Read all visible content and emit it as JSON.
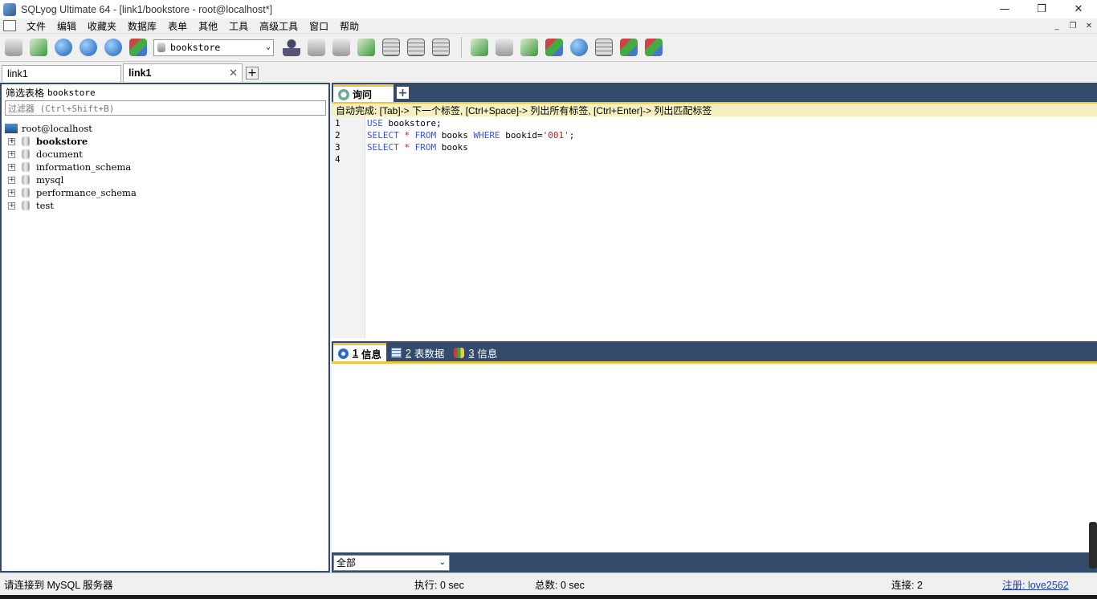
{
  "window": {
    "title": "SQLyog Ultimate 64 - [link1/bookstore - root@localhost*]",
    "minimize": "—",
    "restore": "❐",
    "close": "✕"
  },
  "menu": {
    "items": [
      "文件",
      "编辑",
      "收藏夹",
      "数据库",
      "表单",
      "其他",
      "工具",
      "高级工具",
      "窗口",
      "帮助"
    ],
    "mdi_min": "_",
    "mdi_restore": "❐",
    "mdi_close": "✕"
  },
  "toolbar": {
    "db_selected": "bookstore",
    "dropdown_arrow": "⌄"
  },
  "conn_tabs": [
    {
      "label": "link1"
    },
    {
      "label": "link1",
      "close": "✕"
    }
  ],
  "conn_tab_add": "+",
  "left": {
    "filter_label": "筛选表格",
    "filter_db": "bookstore",
    "filter_placeholder": "过滤器 (Ctrl+Shift+B)",
    "root": "root@localhost",
    "databases": [
      "bookstore",
      "document",
      "information_schema",
      "mysql",
      "performance_schema",
      "test"
    ],
    "expand": "+"
  },
  "editor": {
    "tab_label": "询问",
    "tab_add": "+",
    "autocomplete": "自动完成: [Tab]-> 下一个标签, [Ctrl+Space]-> 列出所有标签, [Ctrl+Enter]-> 列出匹配标签",
    "lines": [
      {
        "n": "1",
        "parts": [
          {
            "t": "USE",
            "c": "kw"
          },
          {
            "t": " bookstore;",
            "c": ""
          }
        ]
      },
      {
        "n": "2",
        "parts": [
          {
            "t": "SELECT",
            "c": "kw"
          },
          {
            "t": " ",
            "c": ""
          },
          {
            "t": "*",
            "c": "op"
          },
          {
            "t": " ",
            "c": ""
          },
          {
            "t": "FROM",
            "c": "kw"
          },
          {
            "t": " books ",
            "c": ""
          },
          {
            "t": "WHERE",
            "c": "kw"
          },
          {
            "t": " bookid=",
            "c": ""
          },
          {
            "t": "'001'",
            "c": "str"
          },
          {
            "t": ";",
            "c": ""
          }
        ]
      },
      {
        "n": "3",
        "parts": [
          {
            "t": "SELECT",
            "c": "kw"
          },
          {
            "t": " ",
            "c": ""
          },
          {
            "t": "*",
            "c": "op"
          },
          {
            "t": " ",
            "c": ""
          },
          {
            "t": "FROM",
            "c": "kw"
          },
          {
            "t": " books",
            "c": ""
          }
        ]
      },
      {
        "n": "4",
        "parts": []
      }
    ]
  },
  "results": {
    "tabs": [
      {
        "num": "1",
        "label": "信息",
        "icon": "info-icon"
      },
      {
        "num": "2",
        "label": "表数据",
        "icon": "table-icon"
      },
      {
        "num": "3",
        "label": "信息",
        "icon": "multi-info-icon"
      }
    ],
    "filter_select": "全部",
    "select_arrow": "⌄"
  },
  "status": {
    "message": "请连接到 MySQL 服务器",
    "exec": "执行: 0 sec",
    "total": "总数: 0 sec",
    "connections": "连接: 2",
    "register": "注册: love2562"
  }
}
